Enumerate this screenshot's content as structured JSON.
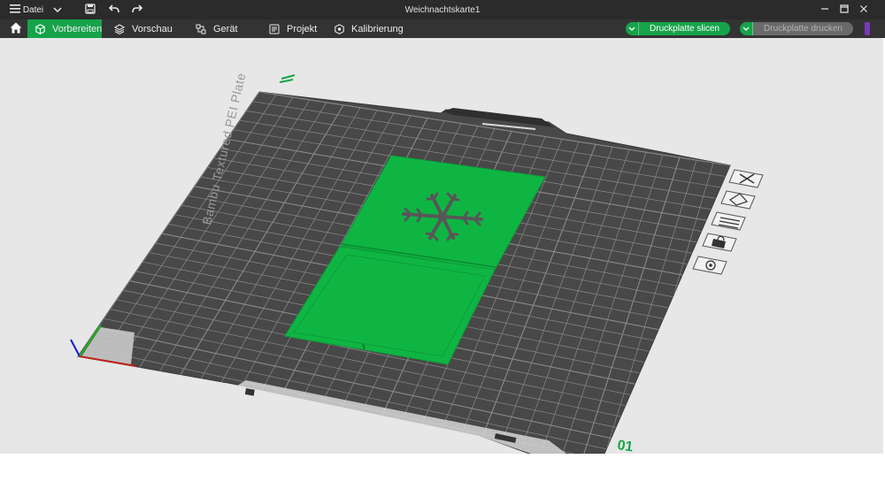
{
  "titlebar": {
    "menu_label": "Datei",
    "document_title": "Weichnachtskarte1"
  },
  "tabs": [
    {
      "label": "Vorbereiten",
      "icon": "cube-icon",
      "active": true
    },
    {
      "label": "Vorschau",
      "icon": "layers-icon",
      "active": false
    },
    {
      "label": "Gerät",
      "icon": "device-icon",
      "active": false
    },
    {
      "label": "Projekt",
      "icon": "project-icon",
      "active": false
    },
    {
      "label": "Kalibrierung",
      "icon": "calibration-icon",
      "active": false
    }
  ],
  "actions": {
    "slice_label": "Druckplatte slicen",
    "print_label": "Druckplatte drucken"
  },
  "plate": {
    "name_text": "Bambu Textured PEI Plate",
    "plate_number": "01",
    "side_tools": [
      "delete-icon",
      "arrange-icon",
      "orient-icon",
      "lock-icon",
      "settings-icon"
    ]
  },
  "colors": {
    "accent": "#16a34a",
    "model": "#0fb543",
    "plate": "#484848",
    "grid": "#8a8a8a",
    "background": "#e6e7e6"
  }
}
